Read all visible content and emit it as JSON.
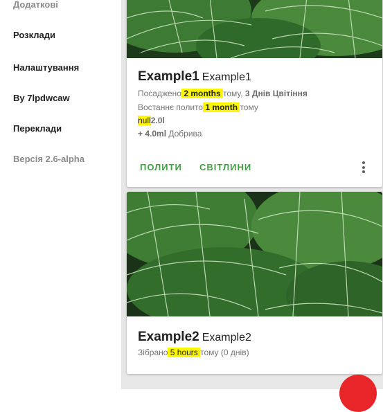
{
  "drawer": {
    "items": [
      {
        "label": "Додаткові"
      },
      {
        "label": "Розклади"
      },
      {
        "label": "Налаштування"
      },
      {
        "label": "By 7lpdwcaw"
      },
      {
        "label": "Переклади"
      },
      {
        "label": "Версія 2.6-alpha"
      }
    ]
  },
  "cards": [
    {
      "name": "Example1",
      "species": "Example1",
      "planted_prefix": "Посаджено",
      "planted_value": " 2 months ",
      "planted_suffix": "тому, ",
      "flowering": "3 Днів Цвітіння",
      "watered_prefix": "Востаннє полито",
      "watered_value": " 1 month ",
      "watered_suffix": "тому",
      "amount_null": "null",
      "amount_value": "2.0l",
      "fertilizer_amount": "+ 4.0ml",
      "fertilizer_label": " Добрива",
      "actions": {
        "water": "ПОЛИТИ",
        "photos": "СВІТЛИНИ"
      }
    },
    {
      "name": "Example2",
      "species": "Example2",
      "harvested_prefix": "Зібрано",
      "harvested_value": " 5 hours ",
      "harvested_suffix": "тому (0 днів)"
    }
  ],
  "colors": {
    "accent": "#43a047",
    "highlight": "#fff700",
    "fab": "#e8262a",
    "background": "#e7e7e7"
  },
  "icons": {
    "more": "more-vert-icon",
    "fab": "add-icon"
  }
}
